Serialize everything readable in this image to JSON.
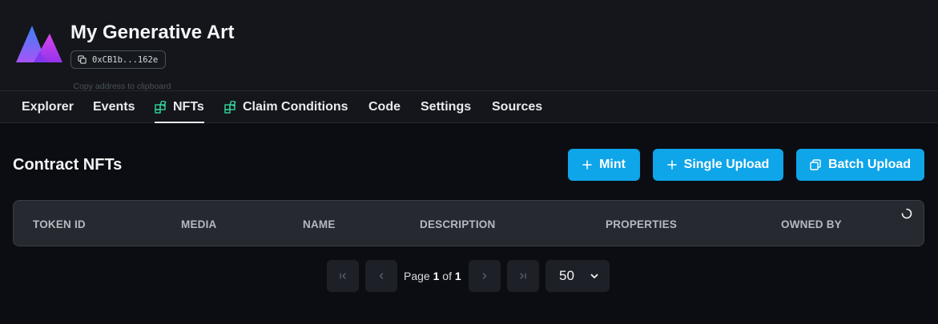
{
  "header": {
    "title": "My Generative Art",
    "address": "0xCB1b...162e",
    "tooltip": "Copy address to clipboard"
  },
  "tabs": [
    {
      "label": "Explorer"
    },
    {
      "label": "Events"
    },
    {
      "label": "NFTs",
      "icon": "extension-icon",
      "active": true
    },
    {
      "label": "Claim Conditions",
      "icon": "extension-icon"
    },
    {
      "label": "Code"
    },
    {
      "label": "Settings"
    },
    {
      "label": "Sources"
    }
  ],
  "section": {
    "title": "Contract NFTs",
    "buttons": [
      {
        "label": "Mint",
        "icon": "plus-icon"
      },
      {
        "label": "Single Upload",
        "icon": "plus-icon"
      },
      {
        "label": "Batch Upload",
        "icon": "copy-icon"
      }
    ]
  },
  "table": {
    "columns": [
      "TOKEN ID",
      "MEDIA",
      "NAME",
      "DESCRIPTION",
      "PROPERTIES",
      "OWNED BY"
    ]
  },
  "pagination": {
    "page_word": "Page",
    "current": "1",
    "of_word": "of",
    "total": "1",
    "page_size": "50"
  },
  "colors": {
    "accent": "#0ea5e9",
    "extension_icon": "#34d399"
  }
}
